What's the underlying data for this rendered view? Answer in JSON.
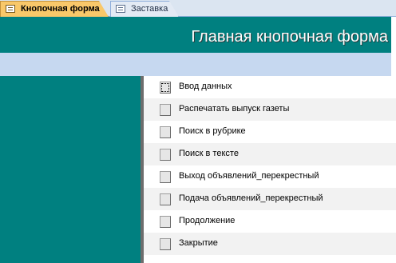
{
  "tabs": [
    {
      "label": "Кнопочная форма",
      "active": true,
      "icon": "form-icon"
    },
    {
      "label": "Заставка",
      "active": false,
      "icon": "form-icon"
    }
  ],
  "header": {
    "title": "Главная кнопочная форма"
  },
  "colors": {
    "teal": "#008080",
    "band": "#c6d8f0",
    "tab_active": "#f9c86a"
  },
  "menu": {
    "items": [
      {
        "label": "Ввод данных",
        "focused": true
      },
      {
        "label": "Распечатать выпуск газеты"
      },
      {
        "label": "Поиск в рубрике"
      },
      {
        "label": "Поиск в тексте"
      },
      {
        "label": "Выход объявлений_перекрестный"
      },
      {
        "label": "Подача объявлений_перекрестный"
      },
      {
        "label": "Продолжение"
      },
      {
        "label": "Закрытие"
      }
    ]
  }
}
